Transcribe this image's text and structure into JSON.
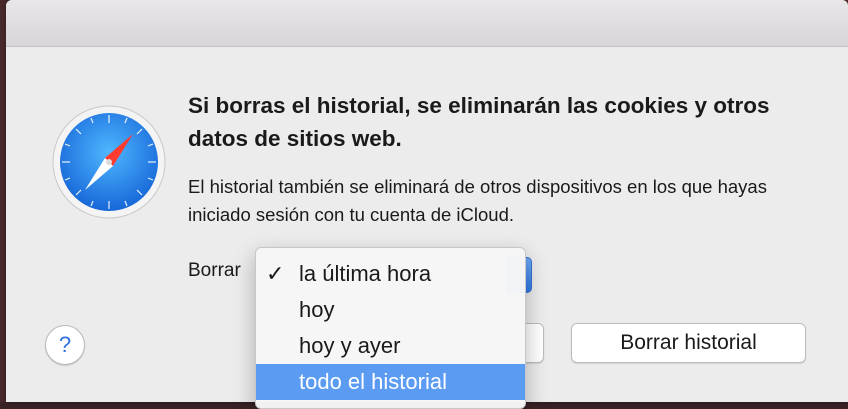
{
  "dialog": {
    "headline": "Si borras el historial, se eliminarán las cookies y otros datos de sitios web.",
    "message": "El historial también se eliminará de otros dispositivos en los que hayas iniciado sesión con tu cuenta de iCloud.",
    "clear_label": "Borrar",
    "help_label": "?",
    "clear_button_label": "Borrar historial",
    "app_icon": "safari-compass-icon"
  },
  "menu": {
    "items": [
      {
        "label": "la última hora",
        "checked": true,
        "check": "✓"
      },
      {
        "label": "hoy",
        "checked": false,
        "check": ""
      },
      {
        "label": "hoy y ayer",
        "checked": false,
        "check": ""
      },
      {
        "label": "todo el historial",
        "checked": false,
        "highlighted": true,
        "check": ""
      }
    ]
  },
  "colors": {
    "accent": "#2f79e8",
    "menu_highlight": "#5b9cf2",
    "help_glyph": "#2f6fe0"
  }
}
